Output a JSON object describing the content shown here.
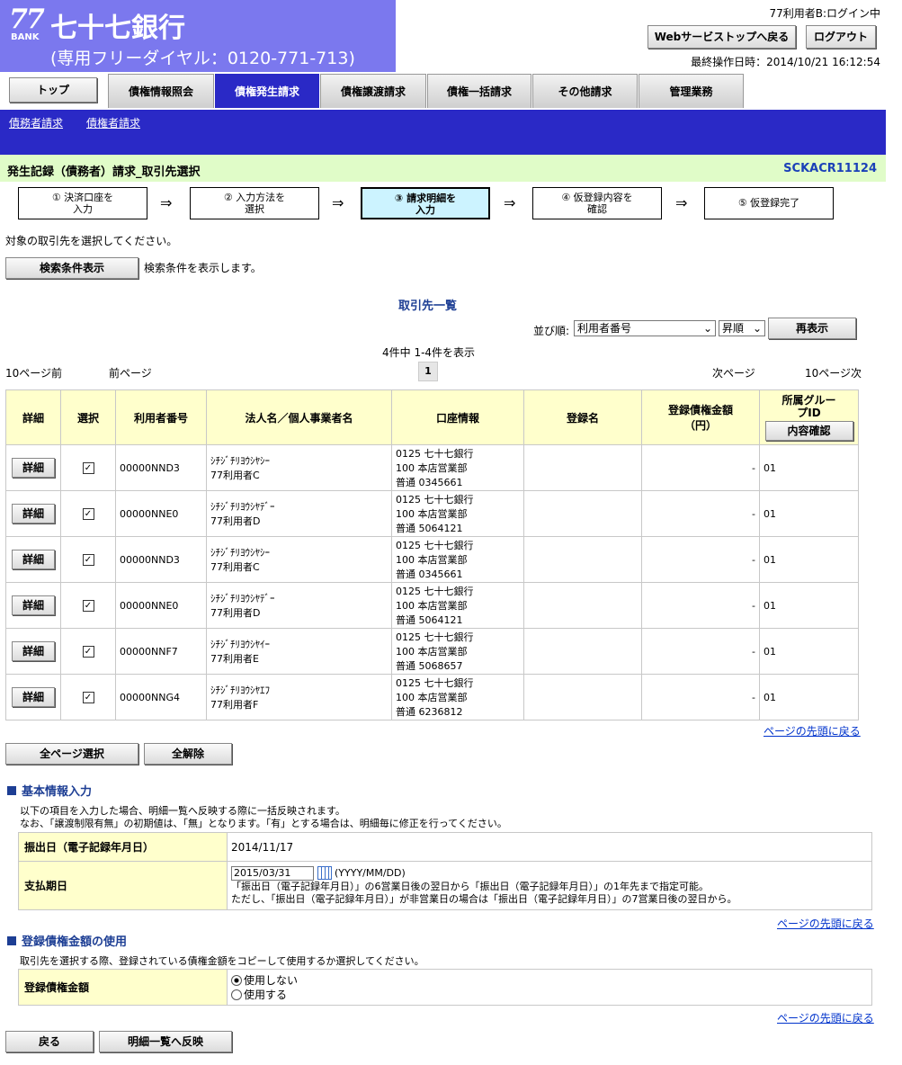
{
  "header": {
    "logo_num": "77",
    "logo_bank": "BANK",
    "bank_name": "七十七銀行",
    "tel": "(専用フリーダイヤル：0120-771-713)",
    "user_status": "77利用者B:ログイン中",
    "web_top_label": "Webサービストップへ戻る",
    "logout_label": "ログアウト",
    "last_op": "最終操作日時：2014/10/21 16:12:54"
  },
  "tabs": {
    "top": "トップ",
    "items": [
      "債権情報照会",
      "債権発生請求",
      "債権譲渡請求",
      "債権一括請求",
      "その他請求",
      "管理業務"
    ]
  },
  "subnav": [
    "債務者請求",
    "債権者請求"
  ],
  "title": {
    "text": "発生記録（債務者）請求_取引先選択",
    "code": "SCKACR11124"
  },
  "steps": [
    {
      "l1": "① 決済口座を",
      "l2": "入力"
    },
    {
      "l1": "② 入力方法を",
      "l2": "選択"
    },
    {
      "l1": "③ 請求明細を",
      "l2": "入力"
    },
    {
      "l1": "④ 仮登録内容を",
      "l2": "確認"
    },
    {
      "l1": "⑤ 仮登録完了",
      "l2": ""
    }
  ],
  "arrow": "⇒",
  "instruction": "対象の取引先を選択してください。",
  "search": {
    "button": "検索条件表示",
    "desc": "検索条件を表示します。"
  },
  "list_title": "取引先一覧",
  "sort": {
    "label": "並び順:",
    "field": "利用者番号",
    "order": "昇順",
    "redisplay": "再表示"
  },
  "count_text": "4件中 1-4件を表示",
  "pager": {
    "prev10": "10ページ前",
    "prev": "前ページ",
    "page": "1",
    "next": "次ページ",
    "next10": "10ページ次"
  },
  "table": {
    "headers": [
      "詳細",
      "選択",
      "利用者番号",
      "法人名／個人事業者名",
      "口座情報",
      "登録名",
      "登録債権金額（円）",
      "所属グループID"
    ],
    "confirm_btn": "内容確認",
    "detail_btn": "詳細",
    "check": "✓",
    "rows": [
      {
        "id": "00000NND3",
        "kana": "ｼﾁｼﾞﾁﾘﾖｳｼﾔｼｰ",
        "name": "77利用者C",
        "acc1": "0125 七十七銀行",
        "acc2": "100 本店営業部",
        "acc3": "普通 0345661",
        "reg": "",
        "amount": "-",
        "group": "01"
      },
      {
        "id": "00000NNE0",
        "kana": "ｼﾁｼﾞﾁﾘﾖｳｼﾔﾃﾞｰ",
        "name": "77利用者D",
        "acc1": "0125 七十七銀行",
        "acc2": "100 本店営業部",
        "acc3": "普通 5064121",
        "reg": "",
        "amount": "-",
        "group": "01"
      },
      {
        "id": "00000NND3",
        "kana": "ｼﾁｼﾞﾁﾘﾖｳｼﾔｼｰ",
        "name": "77利用者C",
        "acc1": "0125 七十七銀行",
        "acc2": "100 本店営業部",
        "acc3": "普通 0345661",
        "reg": "",
        "amount": "-",
        "group": "01"
      },
      {
        "id": "00000NNE0",
        "kana": "ｼﾁｼﾞﾁﾘﾖｳｼﾔﾃﾞｰ",
        "name": "77利用者D",
        "acc1": "0125 七十七銀行",
        "acc2": "100 本店営業部",
        "acc3": "普通 5064121",
        "reg": "",
        "amount": "-",
        "group": "01"
      },
      {
        "id": "00000NNF7",
        "kana": "ｼﾁｼﾞﾁﾘﾖｳｼﾔｲｰ",
        "name": "77利用者E",
        "acc1": "0125 七十七銀行",
        "acc2": "100 本店営業部",
        "acc3": "普通 5068657",
        "reg": "",
        "amount": "-",
        "group": "01"
      },
      {
        "id": "00000NNG4",
        "kana": "ｼﾁｼﾞﾁﾘﾖｳｼﾔｴﾌ",
        "name": "77利用者F",
        "acc1": "0125 七十七銀行",
        "acc2": "100 本店営業部",
        "acc3": "普通 6236812",
        "reg": "",
        "amount": "-",
        "group": "01"
      }
    ]
  },
  "page_top_link": "ページの先頭に戻る",
  "select_all": "全ページ選択",
  "clear_all": "全解除",
  "basic": {
    "heading": "基本情報入力",
    "note1": "以下の項目を入力した場合、明細一覧へ反映する際に一括反映されます。",
    "note2": "なお、「譲渡制限有無」の初期値は、「無」となります。「有」とする場合は、明細毎に修正を行ってください。",
    "issue_label": "振出日（電子記録年月日）",
    "issue_value": "2014/11/17",
    "due_label": "支払期日",
    "due_value": "2015/03/31",
    "due_format": "(YYYY/MM/DD)",
    "due_note1": "「振出日（電子記録年月日）」の6営業日後の翌日から「振出日（電子記録年月日）」の1年先まで指定可能。",
    "due_note2": "ただし、「振出日（電子記録年月日）」が非営業日の場合は「振出日（電子記録年月日）」の7営業日後の翌日から。"
  },
  "amount_use": {
    "heading": "登録債権金額の使用",
    "note": "取引先を選択する際、登録されている債権金額をコピーして使用するか選択してください。",
    "label": "登録債権金額",
    "opt1": "使用しない",
    "opt2": "使用する"
  },
  "footer": {
    "back": "戻る",
    "reflect": "明細一覧へ反映"
  }
}
